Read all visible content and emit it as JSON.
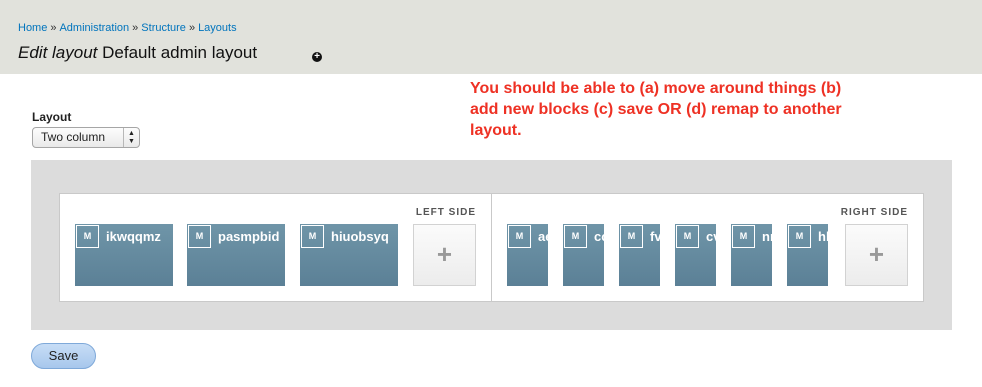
{
  "header": {
    "breadcrumb": [
      "Home",
      "Administration",
      "Structure",
      "Layouts"
    ],
    "breadcrumb_separator": "»",
    "title_emphasis": "Edit layout",
    "title_text": "Default admin layout",
    "title_icon": "plus-circle-icon"
  },
  "annotation": {
    "text": "You should be able to (a) move around things (b) add new blocks (c) save OR (d) remap to another layout."
  },
  "layout_field": {
    "label": "Layout",
    "selected": "Two column"
  },
  "regions": {
    "left": {
      "title": "LEFT SIDE",
      "blocks": [
        {
          "badge": "M",
          "label": "ikwqqmz"
        },
        {
          "badge": "M",
          "label": "pasmpbid"
        },
        {
          "badge": "M",
          "label": "hiuobsyq"
        }
      ],
      "add_label": "+"
    },
    "right": {
      "title": "RIGHT SIDE",
      "blocks": [
        {
          "badge": "M",
          "label": "ae"
        },
        {
          "badge": "M",
          "label": "co"
        },
        {
          "badge": "M",
          "label": "fv"
        },
        {
          "badge": "M",
          "label": "cv"
        },
        {
          "badge": "M",
          "label": "nn"
        },
        {
          "badge": "M",
          "label": "hl"
        }
      ],
      "add_label": "+"
    }
  },
  "actions": {
    "save_label": "Save"
  },
  "colors": {
    "header_bg": "#e1e2dc",
    "link": "#0074bd",
    "annotation": "#ee3124",
    "block": "#5f8499",
    "canvas": "#dcdcdc",
    "save_button": "#b7d2f1"
  }
}
